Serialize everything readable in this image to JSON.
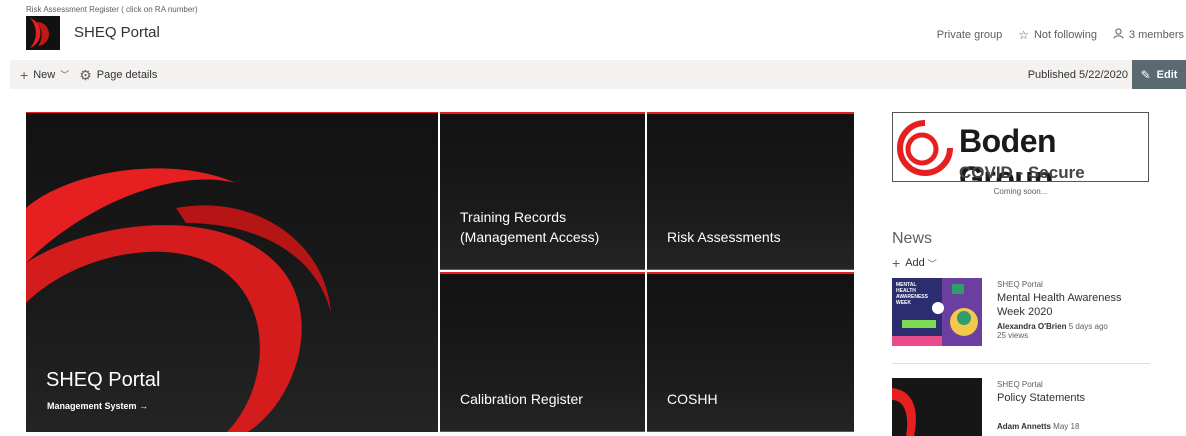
{
  "breadcrumb": "Risk Assessment Register ( click on RA number)",
  "site": {
    "title": "SHEQ Portal",
    "privacy": "Private group",
    "follow_label": "Not following",
    "members_label": "3 members"
  },
  "command_bar": {
    "new_label": "New",
    "page_details_label": "Page details",
    "published_label": "Published 5/22/2020",
    "edit_label": "Edit"
  },
  "hero": {
    "main": {
      "title": "SHEQ Portal",
      "link_label": "Management System →"
    },
    "tiles": [
      {
        "label": "Training Records (Management Access)"
      },
      {
        "label": "Risk Assessments"
      },
      {
        "label": "Calibration Register"
      },
      {
        "label": "COSHH"
      }
    ]
  },
  "promo": {
    "company": "Boden Group",
    "subtitle": "COVID - Secure",
    "caption": "Coming soon..."
  },
  "news": {
    "title": "News",
    "add_label": "Add",
    "items": [
      {
        "site": "SHEQ Portal",
        "headline": "Mental Health Awareness Week 2020",
        "author": "Alexandra O'Brien",
        "time": "5 days ago",
        "views": "25 views",
        "thumb_text": "MENTAL HEALTH AWARENESS WEEK"
      },
      {
        "site": "SHEQ Portal",
        "headline": "Policy Statements",
        "author": "Adam Annetts",
        "time": "May 18",
        "views": ""
      }
    ]
  },
  "colors": {
    "brand_red": "#e62020",
    "tile_dark": "#141414",
    "command_bg": "#f3f2f1",
    "edit_bg": "#5a6a70"
  }
}
